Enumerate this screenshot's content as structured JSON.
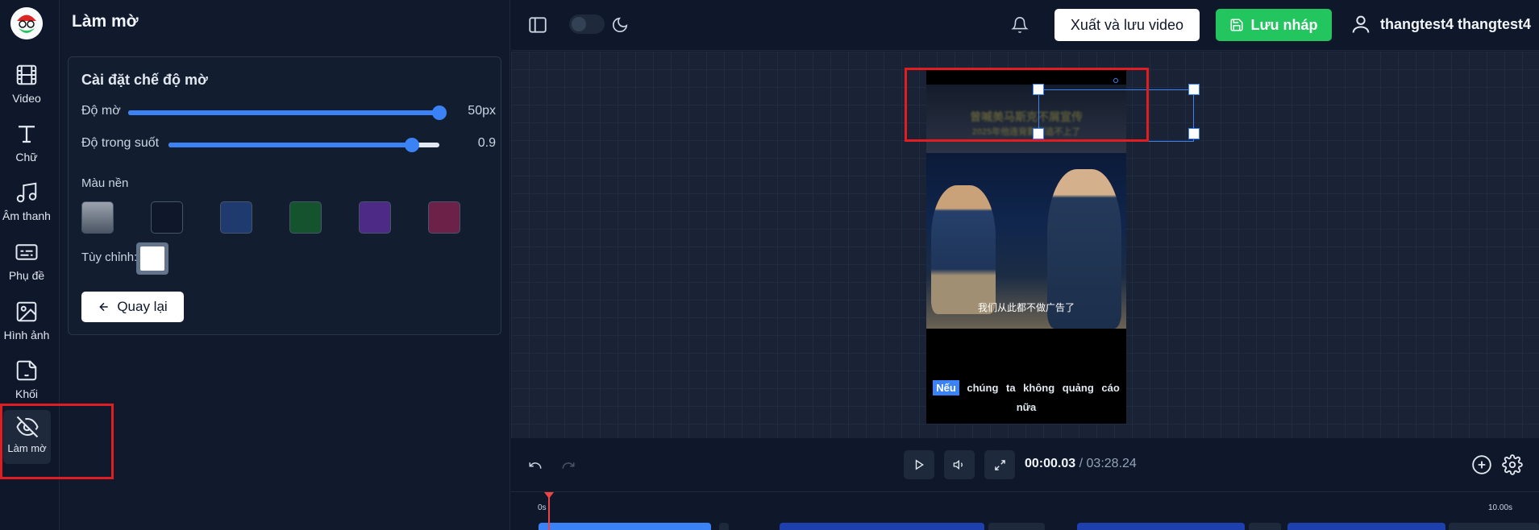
{
  "rail": {
    "logo": "app-logo",
    "items": [
      {
        "label": "Video",
        "icon": "film-icon"
      },
      {
        "label": "Chữ",
        "icon": "text-icon"
      },
      {
        "label": "Âm thanh",
        "icon": "music-icon"
      },
      {
        "label": "Phụ đề",
        "icon": "subtitles-icon"
      },
      {
        "label": "Hình ảnh",
        "icon": "image-icon"
      },
      {
        "label": "Khối",
        "icon": "sticker-icon"
      },
      {
        "label": "Làm mờ",
        "icon": "eye-off-icon"
      }
    ]
  },
  "panel": {
    "title": "Làm mờ",
    "card_title": "Cài đặt chế độ mờ",
    "blur": {
      "label": "Độ mờ",
      "value": "50px",
      "fraction": 1.0
    },
    "opacity": {
      "label": "Độ trong suốt",
      "value": "0.9",
      "fraction": 0.9
    },
    "bg_label": "Màu nền",
    "swatches": [
      "gray-gradient",
      "dark",
      "blue",
      "green",
      "purple",
      "pink"
    ],
    "custom_label": "Tùy chỉnh:",
    "back_label": "Quay lại"
  },
  "topbar": {
    "export_label": "Xuất và lưu video",
    "draft_label": "Lưu nháp",
    "username": "thangtest4 thangtest4"
  },
  "video": {
    "overlay_line1": "曾喊美马斯克不屑宣传",
    "overlay_line2": "2025年他连背影都追不上了",
    "chinese_subtitle": "我们从此都不做广告了",
    "caption_highlight": "Nếu",
    "caption_rest": "chúng ta không quảng cáo nữa"
  },
  "controls": {
    "current_time": "00:00.03",
    "separator": "/",
    "duration": "03:28.24"
  },
  "timeline": {
    "tick_start": "0s",
    "tick_end": "10.00s"
  },
  "colors": {
    "accent": "#3b82f6",
    "green": "#22c55e",
    "highlight_red": "#e11d21"
  }
}
